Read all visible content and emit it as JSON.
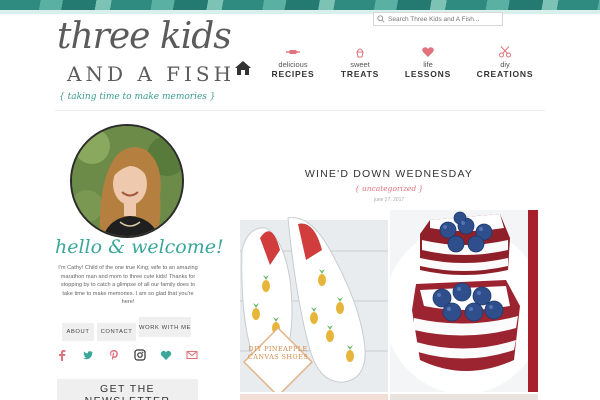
{
  "header": {
    "search_placeholder": "Search Three Kids and A Fish...",
    "logo": {
      "line1": "three kids",
      "line2": "AND A FISH",
      "tagline": "taking time to make memories"
    }
  },
  "nav": {
    "items": [
      {
        "small": "delicious",
        "big": "RECIPES",
        "icon": "rolling-pin-icon"
      },
      {
        "small": "sweet",
        "big": "TREATS",
        "icon": "cupcake-icon"
      },
      {
        "small": "life",
        "big": "LESSONS",
        "icon": "heart-icon"
      },
      {
        "small": "diy",
        "big": "CREATIONS",
        "icon": "scissors-icon"
      }
    ],
    "home_icon": "home-icon"
  },
  "sidebar": {
    "welcome": "hello & welcome!",
    "intro": "I'm Cathy! Child of the one true King; wife to an amazing marathon man and mom to three cute kids! Thanks for stopping by to catch a glimpse of all our family does to take time to make memories. I am so glad that you're here!",
    "buttons": {
      "about": "ABOUT",
      "contact": "CONTACT",
      "work_with_me": "WORK WITH ME"
    },
    "social_icons": [
      "facebook-icon",
      "twitter-icon",
      "pinterest-icon",
      "instagram-icon",
      "bloglovin-icon",
      "email-icon"
    ],
    "newsletter_label": "GET THE NEWSLETTER"
  },
  "post": {
    "title": "WINE'D DOWN WEDNESDAY",
    "category": "uncategorized",
    "date": "june 27, 2017",
    "images": [
      {
        "label": "DIY PINEAPPLE CANVAS SHOES"
      },
      {
        "label": ""
      }
    ]
  },
  "colors": {
    "accent_teal": "#3aa79a",
    "accent_pink": "#e2727d",
    "text_dark": "#333333",
    "button_bg": "#efefef"
  }
}
